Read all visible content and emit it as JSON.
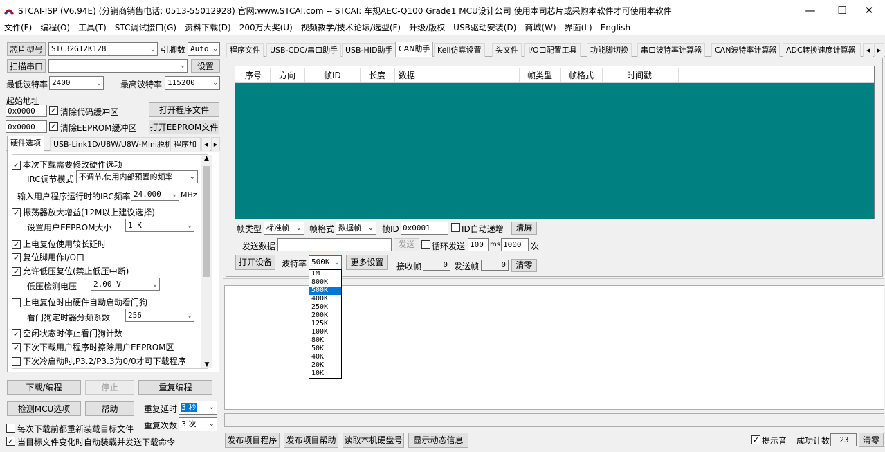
{
  "window": {
    "title": "STCAI-ISP (V6.94E) (分销商销售电话: 0513-55012928) 官网:www.STCAI.com  -- STCAI: 车规AEC-Q100 Grade1 MCU设计公司 使用本司芯片或采购本软件才可使用本软件",
    "minimize": "—",
    "maximize": "☐",
    "close": "✕"
  },
  "menu": [
    "文件(F)",
    "编程(O)",
    "工具(T)",
    "STC调试接口(G)",
    "资料下载(D)",
    "200万大奖(U)",
    "视频教学/技术论坛/选型(F)",
    "升级/版权",
    "USB驱动安装(D)",
    "商城(W)",
    "界面(L)",
    "English"
  ],
  "left": {
    "chip_type_label": "芯片型号",
    "chip_type_value": "STC32G12K128",
    "pin_count_label": "引脚数",
    "pin_count_value": "Auto",
    "scan_port_label": "扫描串口",
    "scan_port_value": "",
    "settings_label": "设置",
    "min_baud_label": "最低波特率",
    "min_baud_value": "2400",
    "max_baud_label": "最高波特率",
    "max_baud_value": "115200",
    "start_addr_label": "起始地址",
    "code_addr": "0x0000",
    "clear_code_label": "清除代码缓冲区",
    "open_prog_label": "打开程序文件",
    "eeprom_addr": "0x0000",
    "clear_eeprom_label": "清除EEPROM缓冲区",
    "open_eeprom_label": "打开EEPROM文件",
    "tabs": [
      "硬件选项",
      "USB-Link1D/U8W/U8W-Mini脱机",
      "程序加"
    ],
    "hw": {
      "modify_hw": "本次下载需要修改硬件选项",
      "irc_mode_label": "IRC调节模式",
      "irc_mode_value": "不调节,使用内部预置的频率",
      "irc_freq_label": "输入用户程序运行时的IRC频率",
      "irc_freq_value": "24.000",
      "irc_freq_unit": "MHz",
      "osc_gain": "振荡器放大增益(12M以上建议选择)",
      "eeprom_size_label": "设置用户EEPROM大小",
      "eeprom_size_value": "1    K",
      "long_reset": "上电复位使用较长延时",
      "reset_io": "复位脚用作I/O口",
      "lvd_reset": "允许低压复位(禁止低压中断)",
      "lvd_voltage_label": "低压检测电压",
      "lvd_voltage_value": "2.00 V",
      "wdt_auto": "上电复位时由硬件自动启动看门狗",
      "wdt_div_label": "看门狗定时器分频系数",
      "wdt_div_value": "256",
      "wdt_idle_stop": "空闲状态时停止看门狗计数",
      "erase_eeprom": "下次下载用户程序时擦除用户EEPROM区",
      "p32_p33": "下次冷启动时,P3.2/P3.3为0/0才可下载程序"
    },
    "download_label": "下载/编程",
    "stop_label": "停止",
    "reprogram_label": "重复编程",
    "check_mcu_label": "检测MCU选项",
    "help_label": "帮助",
    "repeat_delay_label": "重复延时",
    "repeat_delay_value": "3 秒",
    "repeat_count_label": "重复次数",
    "repeat_count_value": "3 次",
    "reload_each": "每次下载前都重新装载目标文件",
    "auto_reload": "当目标文件变化时自动装载并发送下载命令"
  },
  "right": {
    "tabs": [
      "程序文件",
      "USB-CDC/串口助手",
      "USB-HID助手",
      "CAN助手",
      "Keil仿真设置",
      "头文件",
      "I/O口配置工具",
      "功能脚切换",
      "串口波特率计算器",
      "CAN波特率计算器",
      "ADC转换速度计算器"
    ],
    "grid_headers": [
      "序号",
      "方向",
      "帧ID",
      "长度",
      "数据",
      "帧类型",
      "帧格式",
      "时间戳"
    ],
    "frame_type_label": "帧类型",
    "frame_type_value": "标准帧",
    "frame_format_label": "帧格式",
    "frame_format_value": "数据帧",
    "frame_id_label": "帧ID",
    "frame_id_value": "0x0001",
    "id_auto_inc": "ID自动递增",
    "clear_screen": "清屏",
    "send_data_label": "发送数据",
    "send_data_value": "",
    "send_label": "发送",
    "loop_send": "循环发送",
    "loop_ms_value": "100",
    "ms_unit": "ms",
    "loop_count_value": "1000",
    "count_unit": "次",
    "open_device": "打开设备",
    "baud_label": "波特率",
    "baud_value": "500K",
    "more_settings": "更多设置",
    "recv_label": "接收帧",
    "recv_value": "0",
    "send_frame_label": "发送帧",
    "send_frame_value": "0",
    "clear_zero": "清零",
    "baud_options": [
      "1M",
      "800K",
      "500K",
      "400K",
      "250K",
      "200K",
      "125K",
      "100K",
      "80K",
      "50K",
      "40K",
      "20K",
      "10K"
    ],
    "baud_selected_index": 2
  },
  "bottom": {
    "publish_prog": "发布项目程序",
    "publish_help": "发布项目帮助",
    "read_disk": "读取本机硬盘号",
    "show_dynamic": "显示动态信息",
    "tip_sound": "提示音",
    "success_count_label": "成功计数",
    "success_count_value": "23",
    "clear_zero": "清零"
  },
  "colors": {
    "grid_bg": "#008080",
    "accent": "#0078d7"
  }
}
